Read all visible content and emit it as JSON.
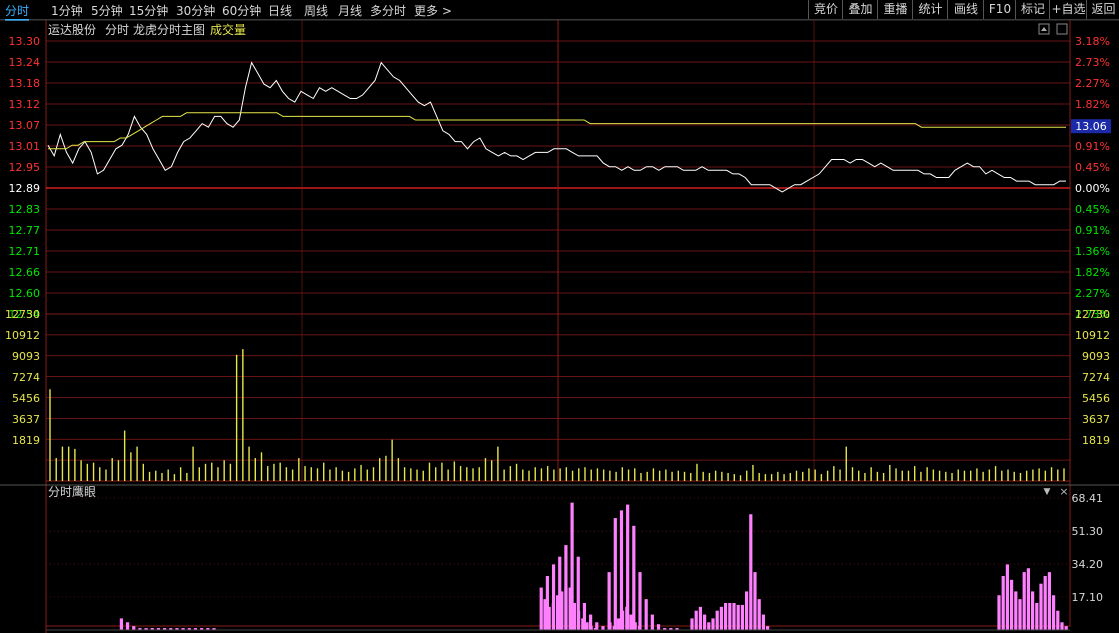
{
  "toolbar": {
    "tabs": [
      "分时",
      "1分钟",
      "5分钟",
      "15分钟",
      "30分钟",
      "60分钟",
      "日线",
      "周线",
      "月线",
      "多分时",
      "更多 >"
    ],
    "active_tab": "分时",
    "right_buttons": [
      "竞价",
      "叠加",
      "重播",
      "统计",
      "画线",
      "F10",
      "标记",
      "+自选",
      "返回"
    ]
  },
  "main_chart": {
    "stock_name": "运达股份",
    "mode_label": "分时",
    "indicator_title": "龙虎分时主图",
    "indicator_sub": "成交量",
    "current_price_tag": "13.06",
    "price_axis": [
      "13.30",
      "13.24",
      "13.18",
      "13.12",
      "13.07",
      "13.01",
      "12.95",
      "12.89",
      "12.83",
      "12.77",
      "12.71",
      "12.66",
      "12.60",
      "12.54"
    ],
    "pct_axis": [
      "3.18%",
      "2.73%",
      "2.27%",
      "1.82%",
      "1.36%",
      "0.91%",
      "0.45%",
      "0.00%",
      "0.45%",
      "0.91%",
      "1.36%",
      "1.82%",
      "2.27%",
      "2.73%"
    ],
    "volume_axis": [
      "12730",
      "10912",
      "9093",
      "7274",
      "5456",
      "3637",
      "1819"
    ]
  },
  "sub_chart": {
    "title": "分时鹰眼",
    "axis": [
      "68.41",
      "51.30",
      "34.20",
      "17.10"
    ]
  },
  "colors": {
    "up": "#ff3232",
    "down": "#00e600",
    "grid": "#8b1a1a",
    "price_line": "#ffffff",
    "avg_line": "#e6e64c",
    "volume": "#e6e64c",
    "eagle": "#ff80ff",
    "accent": "#36b0ff"
  },
  "chart_data": [
    {
      "type": "line",
      "series": [
        {
          "values": [
            13.01,
            12.98,
            13.04,
            12.99,
            12.96,
            13.0,
            13.02,
            12.99,
            12.93,
            12.94,
            12.97,
            13.0,
            13.01,
            13.04,
            13.09,
            13.06,
            13.04,
            13.0,
            12.97,
            12.94,
            12.95,
            12.99,
            13.02,
            13.03,
            13.05,
            13.07,
            13.06,
            13.09,
            13.09,
            13.07,
            13.06,
            13.08,
            13.17,
            13.24,
            13.21,
            13.18,
            13.17,
            13.19,
            13.16,
            13.14,
            13.13,
            13.16,
            13.15,
            13.14,
            13.17,
            13.16,
            13.17,
            13.16,
            13.15,
            13.14,
            13.14,
            13.15,
            13.17,
            13.19,
            13.24,
            13.22,
            13.2,
            13.19,
            13.17,
            13.15,
            13.13,
            13.12,
            13.13,
            13.09,
            13.05,
            13.04,
            13.02,
            13.02,
            13.0,
            13.02,
            13.03,
            13.0,
            12.99,
            12.98,
            12.99,
            12.98,
            12.98,
            12.97,
            12.98,
            12.99,
            12.99,
            12.99,
            13.0,
            13.0,
            13.0,
            12.99,
            12.98,
            12.98,
            12.98,
            12.98,
            12.96,
            12.95,
            12.95,
            12.94,
            12.95,
            12.94,
            12.94,
            12.95,
            12.95,
            12.94,
            12.95,
            12.95,
            12.95,
            12.94,
            12.94,
            12.94,
            12.95,
            12.94,
            12.94,
            12.94,
            12.94,
            12.93,
            12.93,
            12.92,
            12.9,
            12.9,
            12.9,
            12.9,
            12.89,
            12.88,
            12.89,
            12.9,
            12.9,
            12.91,
            12.92,
            12.93,
            12.95,
            12.97,
            12.97,
            12.97,
            12.96,
            12.97,
            12.97,
            12.96,
            12.95,
            12.96,
            12.95,
            12.94,
            12.94,
            12.94,
            12.94,
            12.94,
            12.93,
            12.93,
            12.92,
            12.92,
            12.92,
            12.94,
            12.95,
            12.96,
            12.95,
            12.95,
            12.93,
            12.94,
            12.93,
            12.92,
            12.92,
            12.91,
            12.91,
            12.91,
            12.9,
            12.9,
            12.9,
            12.9,
            12.91,
            12.91
          ]
        },
        {
          "values": [
            13.0,
            13.0,
            13.0,
            13.0,
            13.01,
            13.01,
            13.02,
            13.02,
            13.02,
            13.02,
            13.02,
            13.02,
            13.03,
            13.03,
            13.04,
            13.05,
            13.06,
            13.07,
            13.08,
            13.09,
            13.09,
            13.09,
            13.09,
            13.1,
            13.1,
            13.1,
            13.1,
            13.1,
            13.1,
            13.1,
            13.1,
            13.1,
            13.1,
            13.1,
            13.1,
            13.1,
            13.1,
            13.1,
            13.1,
            13.09,
            13.09,
            13.09,
            13.09,
            13.09,
            13.09,
            13.09,
            13.09,
            13.09,
            13.09,
            13.09,
            13.09,
            13.09,
            13.09,
            13.09,
            13.09,
            13.09,
            13.09,
            13.09,
            13.09,
            13.09,
            13.09,
            13.08,
            13.08,
            13.08,
            13.08,
            13.08,
            13.08,
            13.08,
            13.08,
            13.08,
            13.08,
            13.08,
            13.08,
            13.08,
            13.08,
            13.08,
            13.08,
            13.08,
            13.08,
            13.08,
            13.08,
            13.08,
            13.08,
            13.08,
            13.08,
            13.08,
            13.08,
            13.08,
            13.08,
            13.08,
            13.07,
            13.07,
            13.07,
            13.07,
            13.07,
            13.07,
            13.07,
            13.07,
            13.07,
            13.07,
            13.07,
            13.07,
            13.07,
            13.07,
            13.07,
            13.07,
            13.07,
            13.07,
            13.07,
            13.07,
            13.07,
            13.07,
            13.07,
            13.07,
            13.07,
            13.07,
            13.07,
            13.07,
            13.07,
            13.07,
            13.07,
            13.07,
            13.07,
            13.07,
            13.07,
            13.07,
            13.07,
            13.07,
            13.07,
            13.07,
            13.07,
            13.07,
            13.07,
            13.07,
            13.07,
            13.07,
            13.07,
            13.07,
            13.07,
            13.07,
            13.07,
            13.07,
            13.07,
            13.07,
            13.07,
            13.06,
            13.06,
            13.06,
            13.06,
            13.06,
            13.06,
            13.06,
            13.06,
            13.06,
            13.06,
            13.06,
            13.06,
            13.06,
            13.06,
            13.06,
            13.06,
            13.06,
            13.06,
            13.06,
            13.06,
            13.06,
            13.06,
            13.06,
            13.06,
            13.06
          ]
        }
      ],
      "ylim": [
        12.54,
        13.3
      ]
    },
    {
      "type": "bar",
      "values": [
        8000,
        2000,
        3000,
        3000,
        2800,
        1800,
        1500,
        1600,
        1200,
        1000,
        2000,
        1800,
        4400,
        2500,
        3000,
        1500,
        800,
        900,
        700,
        1000,
        600,
        1200,
        700,
        3000,
        1200,
        1500,
        1600,
        1200,
        1800,
        1500,
        11000,
        11500,
        3000,
        2000,
        2500,
        1300,
        1500,
        1600,
        1200,
        1000,
        2000,
        1300,
        1200,
        1100,
        1600,
        1000,
        1200,
        900,
        800,
        1100,
        1400,
        1000,
        1200,
        2000,
        2200,
        3600,
        2000,
        1200,
        1100,
        1000,
        900,
        1600,
        1200,
        1600,
        1000,
        1700,
        1300,
        1200,
        1100,
        1200,
        2000,
        1800,
        3000,
        1000,
        1300,
        1500,
        1000,
        900,
        1200,
        1100,
        1300,
        1000,
        1100,
        1200,
        900,
        1100,
        1200,
        1000,
        1100,
        1000,
        900,
        800,
        1200,
        1000,
        1100,
        700,
        800,
        1100,
        900,
        1000,
        800,
        900,
        800,
        700,
        1500,
        800,
        700,
        900,
        800,
        700,
        600,
        500,
        900,
        1400,
        700,
        600,
        600,
        800,
        600,
        700,
        900,
        800,
        1100,
        1000,
        600,
        900,
        1300,
        1000,
        3000,
        1200,
        900,
        700,
        1200,
        800,
        700,
        1400,
        1100,
        900,
        900,
        1300,
        800,
        1200,
        1000,
        900,
        800,
        700,
        1000,
        900,
        900,
        1100,
        800,
        1000,
        1300,
        900,
        1000,
        800,
        700,
        900,
        1000,
        1100,
        900,
        1200,
        1000,
        1100
      ],
      "ylim": [
        0,
        12730
      ]
    },
    {
      "type": "bar",
      "values": [
        0,
        0,
        0,
        0,
        0,
        0,
        0,
        0,
        6,
        4,
        2,
        1,
        1,
        1,
        1,
        1,
        1,
        1,
        1,
        1,
        1,
        1,
        1,
        1,
        0,
        0,
        0,
        0,
        0,
        0,
        0,
        0,
        0,
        0,
        0,
        0,
        0,
        0,
        0,
        0,
        0,
        0,
        0,
        0,
        0,
        0,
        0,
        0,
        0,
        0,
        0,
        0,
        0,
        0,
        0,
        0,
        0,
        0,
        0,
        0,
        0,
        0,
        0,
        0,
        0,
        0,
        0,
        0,
        0,
        0,
        0,
        0,
        0,
        0,
        0,
        0,
        22,
        28,
        34,
        38,
        44,
        66,
        38,
        14,
        8,
        4,
        2,
        30,
        58,
        62,
        65,
        54,
        30,
        16,
        8,
        3,
        1,
        1,
        1,
        0,
        0,
        0,
        0,
        0,
        0,
        0,
        0,
        0,
        0,
        0,
        0,
        0,
        0,
        0,
        0,
        0,
        0,
        0,
        0,
        0,
        0,
        0,
        0,
        0,
        0,
        0,
        0,
        0,
        0,
        0,
        0,
        0,
        0,
        0,
        0,
        0,
        0,
        0,
        0,
        0,
        0,
        0,
        0,
        0,
        0,
        0,
        0,
        0,
        0,
        0,
        0,
        0,
        0,
        0,
        0,
        0,
        0,
        0,
        0,
        0,
        0,
        0
      ],
      "ylim": [
        0,
        68.41
      ]
    }
  ]
}
